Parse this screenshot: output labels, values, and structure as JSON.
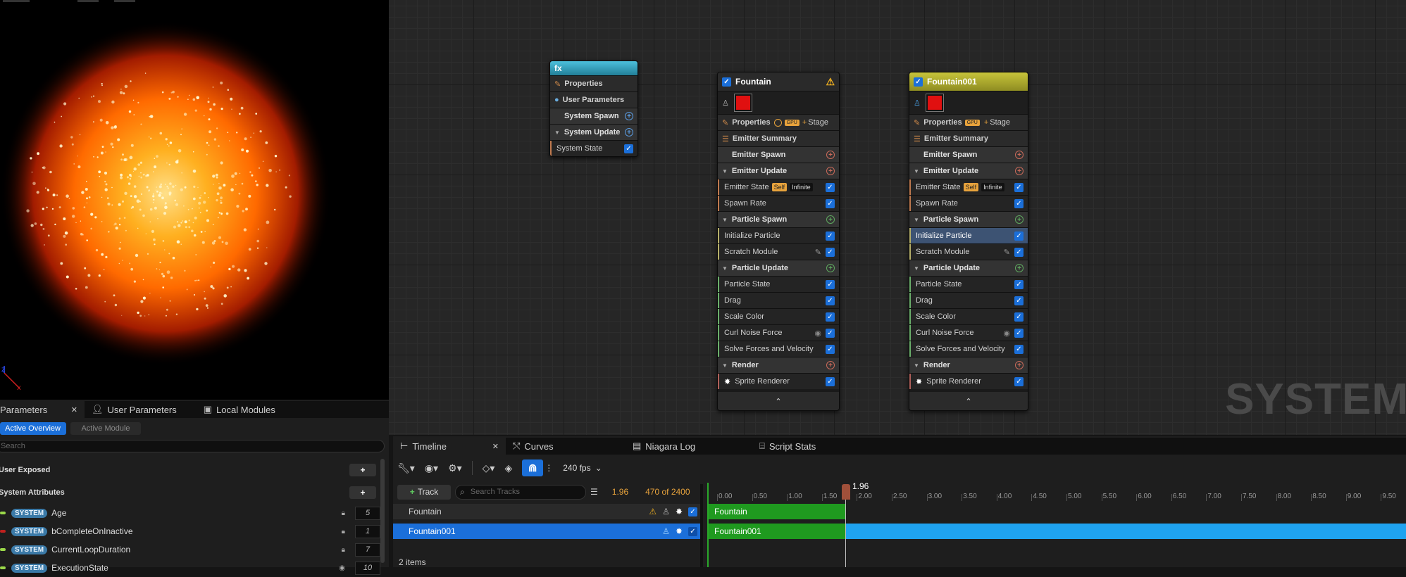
{
  "graph": {
    "watermark": "SYSTEM",
    "system_node": {
      "title": "fx",
      "rows": [
        "Properties",
        "User Parameters",
        "System Spawn",
        "System Update",
        "System State"
      ]
    },
    "emitters": [
      {
        "name": "Fountain",
        "properties": "Properties",
        "gpu_tag": "GPU",
        "stage": "Stage",
        "summary": "Emitter Summary",
        "emitter_spawn": "Emitter Spawn",
        "emitter_update": "Emitter Update",
        "emitter_state": "Emitter State",
        "self_tag": "Self",
        "infinite_tag": "Infinite",
        "spawn_rate": "Spawn Rate",
        "particle_spawn": "Particle Spawn",
        "initialize_particle": "Initialize Particle",
        "scratch_module": "Scratch Module",
        "particle_update": "Particle Update",
        "particle_state": "Particle State",
        "drag": "Drag",
        "scale_color": "Scale Color",
        "curl_noise": "Curl Noise Force",
        "solve_forces": "Solve Forces and Velocity",
        "render": "Render",
        "sprite_renderer": "Sprite Renderer"
      },
      {
        "name": "Fountain001",
        "properties": "Properties",
        "gpu_tag": "GPU",
        "stage": "Stage",
        "summary": "Emitter Summary",
        "emitter_spawn": "Emitter Spawn",
        "emitter_update": "Emitter Update",
        "emitter_state": "Emitter State",
        "self_tag": "Self",
        "infinite_tag": "Infinite",
        "spawn_rate": "Spawn Rate",
        "particle_spawn": "Particle Spawn",
        "initialize_particle": "Initialize Particle",
        "scratch_module": "Scratch Module",
        "particle_update": "Particle Update",
        "particle_state": "Particle State",
        "drag": "Drag",
        "scale_color": "Scale Color",
        "curl_noise": "Curl Noise Force",
        "solve_forces": "Solve Forces and Velocity",
        "render": "Render",
        "sprite_renderer": "Sprite Renderer"
      }
    ]
  },
  "params_panel": {
    "tabs": [
      "Parameters",
      "User Parameters",
      "Local Modules"
    ],
    "sub_tabs": [
      "Active Overview",
      "Active Module"
    ],
    "search_placeholder": "Search",
    "sections": [
      "User Exposed",
      "System Attributes"
    ],
    "attributes": [
      {
        "badge": "SYSTEM",
        "name": "Age",
        "value": "5",
        "color": "#9bd94a"
      },
      {
        "badge": "SYSTEM",
        "name": "bCompleteOnInactive",
        "value": "1",
        "color": "#c0201e"
      },
      {
        "badge": "SYSTEM",
        "name": "CurrentLoopDuration",
        "value": "7",
        "color": "#9bd94a"
      },
      {
        "badge": "SYSTEM",
        "name": "ExecutionState",
        "value": "10",
        "color": "#9bd94a"
      }
    ]
  },
  "timeline_panel": {
    "tabs": [
      "Timeline",
      "Curves",
      "Niagara Log",
      "Script Stats"
    ],
    "fps": "240 fps",
    "track_button": "Track",
    "search_placeholder": "Search Tracks",
    "current_time": "1.96",
    "frame_info": "470 of 2400",
    "playhead_label": "1.96",
    "ticks": [
      "0.00",
      "0.50",
      "1.00",
      "1.50",
      "2.00",
      "2.50",
      "3.00",
      "3.50",
      "4.00",
      "4.50",
      "5.00",
      "5.50",
      "6.00",
      "6.50",
      "7.00",
      "7.50",
      "8.00",
      "8.50",
      "9.00",
      "9.50"
    ],
    "tracks": [
      {
        "name": "Fountain",
        "bar_label": "Fountain"
      },
      {
        "name": "Fountain001",
        "bar_label": "Fountain001"
      }
    ],
    "items_count": "2 items"
  },
  "colors": {
    "accent": "#1b6fd9",
    "track_green": "#1f9a1f",
    "track_blue": "#1fa3f0",
    "fountain_header": "#2a2a2a",
    "fountain001_header": "#a5a52a",
    "system_header": "#3aa7c7"
  }
}
